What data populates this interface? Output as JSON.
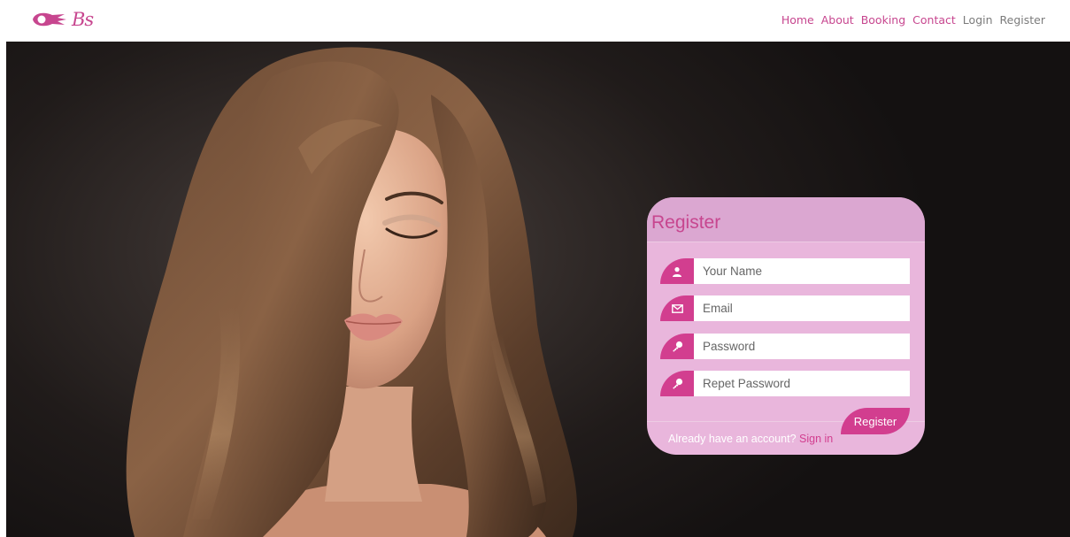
{
  "nav": {
    "logo_text": "Bs",
    "links": [
      "Home",
      "About",
      "Booking",
      "Contact",
      "Login",
      "Register"
    ]
  },
  "form": {
    "title": "Register",
    "fields": [
      {
        "placeholder": "Your Name",
        "icon": "user-icon"
      },
      {
        "placeholder": "Email",
        "icon": "envelope-icon"
      },
      {
        "placeholder": "Password",
        "icon": "key-icon"
      },
      {
        "placeholder": "Repet Password",
        "icon": "key-icon"
      }
    ],
    "submit_label": "Register",
    "footer_text": "Already have an account?",
    "footer_link": "Sign in"
  },
  "colors": {
    "accent": "#c7468f",
    "card": "#e9b6dc",
    "icon_bg": "#d23e8f"
  }
}
